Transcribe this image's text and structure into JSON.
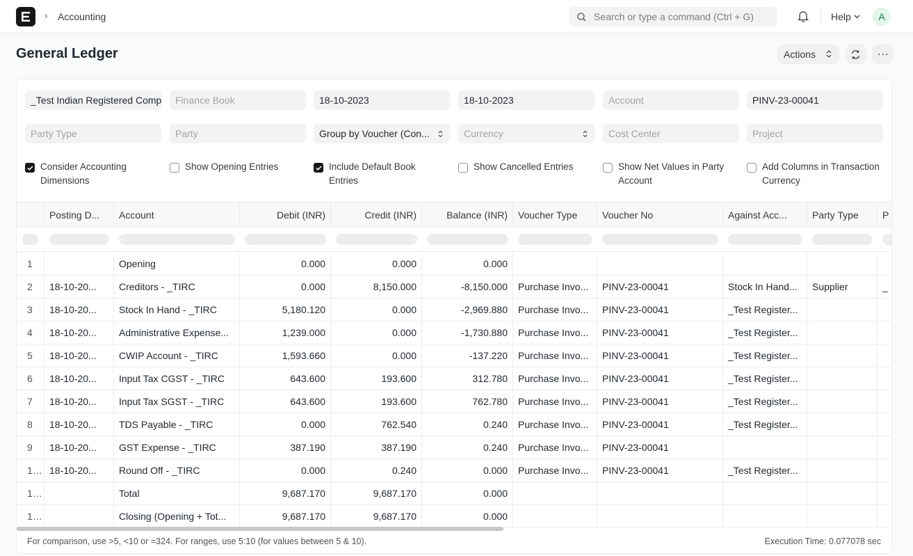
{
  "navbar": {
    "breadcrumb": "Accounting",
    "search_placeholder": "Search or type a command (Ctrl + G)",
    "help_label": "Help",
    "avatar_initial": "A"
  },
  "page": {
    "title": "General Ledger",
    "actions_label": "Actions",
    "more_label": "..."
  },
  "filters": {
    "company": "_Test Indian Registered Company",
    "finance_book": "Finance Book",
    "from_date": "18-10-2023",
    "to_date": "18-10-2023",
    "account": "Account",
    "voucher_no": "PINV-23-00041",
    "party_type": "Party Type",
    "party": "Party",
    "group_by": "Group by Voucher (Con...",
    "currency": "Currency",
    "cost_center": "Cost Center",
    "project": "Project"
  },
  "checkboxes": [
    {
      "label": "Consider Accounting Dimensions",
      "checked": true
    },
    {
      "label": "Show Opening Entries",
      "checked": false
    },
    {
      "label": "Include Default Book Entries",
      "checked": true
    },
    {
      "label": "Show Cancelled Entries",
      "checked": false
    },
    {
      "label": "Show Net Values in Party Account",
      "checked": false
    },
    {
      "label": "Add Columns in Transaction Currency",
      "checked": false
    }
  ],
  "table": {
    "columns": [
      "Posting D...",
      "Account",
      "Debit (INR)",
      "Credit (INR)",
      "Balance (INR)",
      "Voucher Type",
      "Voucher No",
      "Against Acc...",
      "Party Type",
      "P"
    ],
    "rows": [
      {
        "idx": "1",
        "date": "",
        "account": "Opening",
        "debit": "0.000",
        "credit": "0.000",
        "balance": "0.000",
        "vtype": "",
        "vno": "",
        "against": "",
        "ptype": "",
        "p": ""
      },
      {
        "idx": "2",
        "date": "18-10-20...",
        "account": "Creditors - _TIRC",
        "debit": "0.000",
        "credit": "8,150.000",
        "balance": "-8,150.000",
        "vtype": "Purchase Invo...",
        "vno": "PINV-23-00041",
        "against": "Stock In Hand...",
        "ptype": "Supplier",
        "p": "_"
      },
      {
        "idx": "3",
        "date": "18-10-20...",
        "account": "Stock In Hand - _TIRC",
        "debit": "5,180.120",
        "credit": "0.000",
        "balance": "-2,969.880",
        "vtype": "Purchase Invo...",
        "vno": "PINV-23-00041",
        "against": "_Test Register...",
        "ptype": "",
        "p": ""
      },
      {
        "idx": "4",
        "date": "18-10-20...",
        "account": "Administrative Expense...",
        "debit": "1,239.000",
        "credit": "0.000",
        "balance": "-1,730.880",
        "vtype": "Purchase Invo...",
        "vno": "PINV-23-00041",
        "against": "_Test Register...",
        "ptype": "",
        "p": ""
      },
      {
        "idx": "5",
        "date": "18-10-20...",
        "account": "CWIP Account - _TIRC",
        "debit": "1,593.660",
        "credit": "0.000",
        "balance": "-137.220",
        "vtype": "Purchase Invo...",
        "vno": "PINV-23-00041",
        "against": "_Test Register...",
        "ptype": "",
        "p": ""
      },
      {
        "idx": "6",
        "date": "18-10-20...",
        "account": "Input Tax CGST - _TIRC",
        "debit": "643.600",
        "credit": "193.600",
        "balance": "312.780",
        "vtype": "Purchase Invo...",
        "vno": "PINV-23-00041",
        "against": "_Test Register...",
        "ptype": "",
        "p": ""
      },
      {
        "idx": "7",
        "date": "18-10-20...",
        "account": "Input Tax SGST - _TIRC",
        "debit": "643.600",
        "credit": "193.600",
        "balance": "762.780",
        "vtype": "Purchase Invo...",
        "vno": "PINV-23-00041",
        "against": "_Test Register...",
        "ptype": "",
        "p": ""
      },
      {
        "idx": "8",
        "date": "18-10-20...",
        "account": "TDS Payable - _TIRC",
        "debit": "0.000",
        "credit": "762.540",
        "balance": "0.240",
        "vtype": "Purchase Invo...",
        "vno": "PINV-23-00041",
        "against": "_Test Register...",
        "ptype": "",
        "p": ""
      },
      {
        "idx": "9",
        "date": "18-10-20...",
        "account": "GST Expense - _TIRC",
        "debit": "387.190",
        "credit": "387.190",
        "balance": "0.240",
        "vtype": "Purchase Invo...",
        "vno": "PINV-23-00041",
        "against": "",
        "ptype": "",
        "p": ""
      },
      {
        "idx": "1...",
        "date": "18-10-20...",
        "account": "Round Off - _TIRC",
        "debit": "0.000",
        "credit": "0.240",
        "balance": "0.000",
        "vtype": "Purchase Invo...",
        "vno": "PINV-23-00041",
        "against": "_Test Register...",
        "ptype": "",
        "p": ""
      },
      {
        "idx": "1...",
        "date": "",
        "account": "Total",
        "debit": "9,687.170",
        "credit": "9,687.170",
        "balance": "0.000",
        "vtype": "",
        "vno": "",
        "against": "",
        "ptype": "",
        "p": ""
      },
      {
        "idx": "1...",
        "date": "",
        "account": "Closing (Opening + Tot...",
        "debit": "9,687.170",
        "credit": "9,687.170",
        "balance": "0.000",
        "vtype": "",
        "vno": "",
        "against": "",
        "ptype": "",
        "p": ""
      }
    ]
  },
  "footer": {
    "hint": "For comparison, use >5, <10 or =324. For ranges, use 5:10 (for values between 5 & 10).",
    "execution_time": "Execution Time: 0.077078 sec"
  }
}
